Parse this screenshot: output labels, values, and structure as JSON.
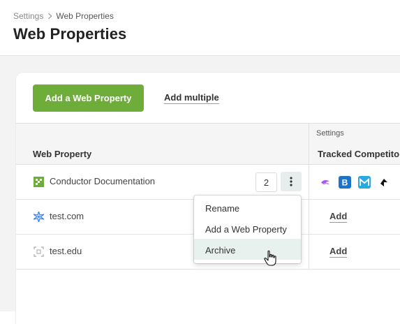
{
  "breadcrumb": {
    "root": "Settings",
    "current": "Web Properties"
  },
  "page_title": "Web Properties",
  "toolbar": {
    "add_button": "Add a Web Property",
    "add_multiple": "Add multiple"
  },
  "table": {
    "group_header": "Settings",
    "columns": {
      "web_property": "Web Property",
      "tracked_competitors": "Tracked Competito"
    },
    "rows": [
      {
        "name": "Conductor Documentation",
        "icon": "grid-logo-icon",
        "count": "2",
        "competitors": [
          "purple-swirl-icon",
          "b-logo-icon",
          "m-logo-icon",
          "arrow-logo-icon"
        ]
      },
      {
        "name": "test.com",
        "icon": "sparkle-logo-icon",
        "action": "Add"
      },
      {
        "name": "test.edu",
        "icon": "placeholder-logo-icon",
        "action": "Add"
      }
    ]
  },
  "context_menu": {
    "items": [
      "Rename",
      "Add a Web Property",
      "Archive"
    ],
    "highlighted": "Archive"
  },
  "colors": {
    "primary": "#6ead3a",
    "menu_highlight": "#e9f1ee",
    "kebab_bg": "#e7ecec"
  }
}
